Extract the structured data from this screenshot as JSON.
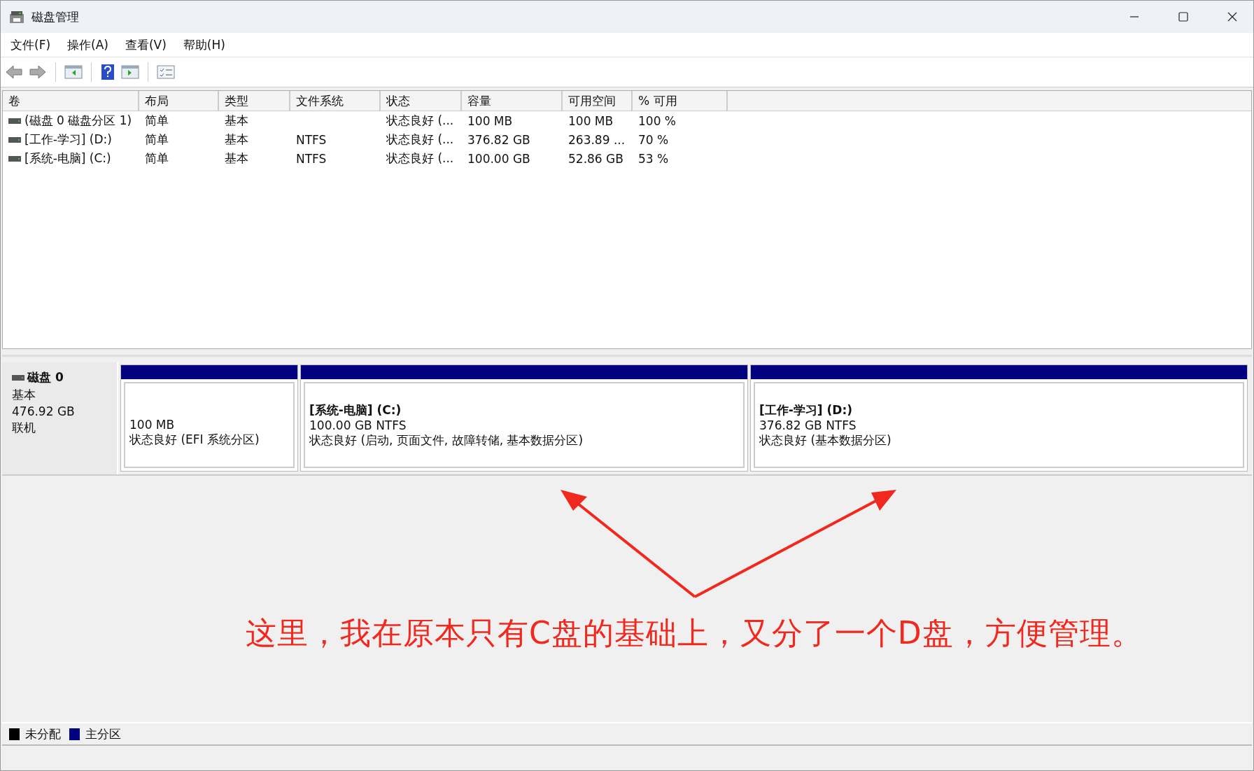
{
  "window": {
    "title": "磁盘管理"
  },
  "menu": [
    "文件(F)",
    "操作(A)",
    "查看(V)",
    "帮助(H)"
  ],
  "table": {
    "columns": [
      "卷",
      "布局",
      "类型",
      "文件系统",
      "状态",
      "容量",
      "可用空间",
      "% 可用"
    ],
    "rows": [
      [
        "(磁盘 0 磁盘分区 1)",
        "简单",
        "基本",
        "",
        "状态良好 (...",
        "100 MB",
        "100 MB",
        "100 %"
      ],
      [
        "[工作-学习] (D:)",
        "简单",
        "基本",
        "NTFS",
        "状态良好 (...",
        "376.82 GB",
        "263.89 ...",
        "70 %"
      ],
      [
        "[系统-电脑] (C:)",
        "简单",
        "基本",
        "NTFS",
        "状态良好 (...",
        "100.00 GB",
        "52.86 GB",
        "53 %"
      ]
    ]
  },
  "disk": {
    "name": "磁盘 0",
    "type": "基本",
    "size": "476.92 GB",
    "state": "联机",
    "partitions": [
      {
        "size": "100 MB",
        "status": "状态良好 (EFI 系统分区)"
      },
      {
        "name": "[系统-电脑]  (C:)",
        "size": "100.00 GB NTFS",
        "status": "状态良好 (启动, 页面文件, 故障转储, 基本数据分区)"
      },
      {
        "name": "[工作-学习]  (D:)",
        "size": "376.82 GB NTFS",
        "status": "状态良好 (基本数据分区)"
      }
    ]
  },
  "annotation": "这里，我在原本只有C盘的基础上，又分了一个D盘，方便管理。",
  "legend": [
    {
      "label": "未分配",
      "color": "#000000"
    },
    {
      "label": "主分区",
      "color": "#000080"
    }
  ]
}
